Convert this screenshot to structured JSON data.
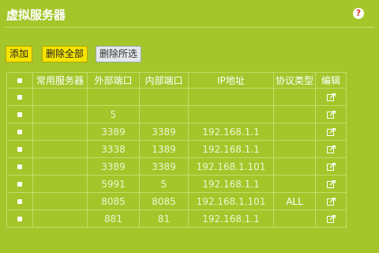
{
  "page": {
    "title": "虚拟服务器",
    "help_icon": "help-icon",
    "help_glyph": "?"
  },
  "toolbar": {
    "add_label": "添加",
    "delete_all_label": "删除全部",
    "delete_selected_label": "删除所选"
  },
  "table": {
    "headers": [
      "常用服务器",
      "外部端口",
      "内部端口",
      "IP地址",
      "协议类型",
      "编辑"
    ],
    "rows": [
      {
        "server": "",
        "ext": "",
        "int": "",
        "ip": "",
        "proto": ""
      },
      {
        "server": "",
        "ext": "5",
        "int": "",
        "ip": "",
        "proto": ""
      },
      {
        "server": "",
        "ext": "3389",
        "int": "3389",
        "ip": "192.168.1.1",
        "proto": ""
      },
      {
        "server": "",
        "ext": "3338",
        "int": "1389",
        "ip": "192.168.1.1",
        "proto": ""
      },
      {
        "server": "",
        "ext": "3389",
        "int": "3389",
        "ip": "192.168.1.101",
        "proto": ""
      },
      {
        "server": "",
        "ext": "5991",
        "int": "5",
        "ip": "192.168.1.1",
        "proto": ""
      },
      {
        "server": "",
        "ext": "8085",
        "int": "8085",
        "ip": "192.168.1.101",
        "proto": "ALL"
      },
      {
        "server": "",
        "ext": "881",
        "int": "81",
        "ip": "192.168.1.1",
        "proto": ""
      }
    ]
  },
  "colors": {
    "background": "#a4c62a",
    "button_yellow": "#f5e400",
    "button_gray": "#e3e7e9",
    "help_red": "#e0392a"
  }
}
